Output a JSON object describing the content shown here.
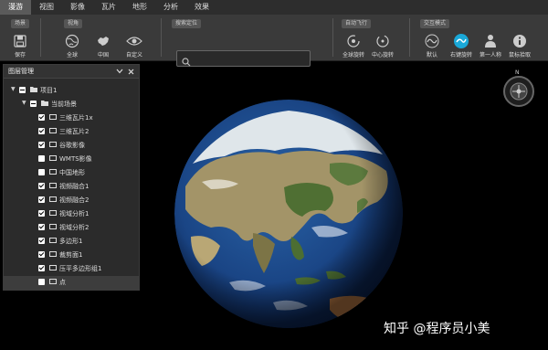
{
  "menu": {
    "tabs": [
      {
        "label": "漫游"
      },
      {
        "label": "视图"
      },
      {
        "label": "影像"
      },
      {
        "label": "瓦片"
      },
      {
        "label": "地形"
      },
      {
        "label": "分析"
      },
      {
        "label": "效果"
      }
    ],
    "active_index": 0
  },
  "ribbon": {
    "scene": {
      "title": "场景",
      "save_label": "保存"
    },
    "view": {
      "title": "视角",
      "global_label": "全球",
      "china_label": "中国",
      "custom_label": "自定义"
    },
    "search": {
      "title": "搜索定位",
      "placeholder": "",
      "value": ""
    },
    "autofly": {
      "title": "自动飞行",
      "global_rotate_label": "全球旋转",
      "center_rotate_label": "中心旋转"
    },
    "interact": {
      "title": "交互模式",
      "default_label": "默认",
      "right_rotate_label": "右键旋转",
      "first_person_label": "第一人称",
      "pick_label": "鼠标拾取"
    }
  },
  "layer_panel": {
    "title": "图层管理",
    "root": {
      "label": "项目1"
    },
    "scene": {
      "label": "当前场景"
    },
    "items": [
      {
        "label": "三维瓦片1x",
        "checked": true
      },
      {
        "label": "三维瓦片2",
        "checked": true
      },
      {
        "label": "谷歌影像",
        "checked": true
      },
      {
        "label": "WMTS影像",
        "checked": false
      },
      {
        "label": "中国地形",
        "checked": false
      },
      {
        "label": "视频融合1",
        "checked": true
      },
      {
        "label": "视频融合2",
        "checked": true
      },
      {
        "label": "视域分析1",
        "checked": true
      },
      {
        "label": "视域分析2",
        "checked": true
      },
      {
        "label": "多边形1",
        "checked": true
      },
      {
        "label": "裁剪面1",
        "checked": true
      },
      {
        "label": "压平多边形组1",
        "checked": true
      },
      {
        "label": "点",
        "checked": false
      }
    ]
  },
  "compass": {
    "north_label": "N"
  },
  "watermark": "知乎 @程序员小美",
  "colors": {
    "accent": "#1aa8d8",
    "panel_bg": "#2b2b2b",
    "ribbon_bg": "#3a3a3a",
    "menubar_bg": "#2d2d2d"
  }
}
